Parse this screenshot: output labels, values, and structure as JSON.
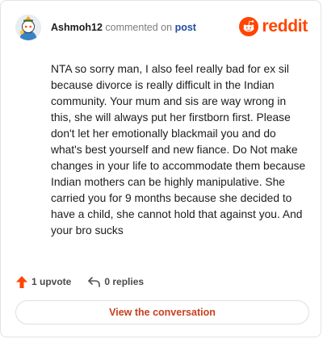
{
  "header": {
    "username": "Ashmoh12",
    "commented_on_text": "commented on",
    "post_link_label": "post",
    "brand_name": "reddit",
    "brand_color": "#ff4500"
  },
  "comment": {
    "body": "NTA so sorry man, I also feel really bad for ex sil because divorce is really difficult in the Indian community. Your mum and sis are way wrong in this, she will always put her firstborn first. Please don't let her emotionally blackmail you and do what's best yourself and new fiance. Do Not make changes in your life to accommodate them because Indian mothers can be highly manipulative. She carried you for 9 months because she decided to have a child, she cannot hold that against you. And your bro sucks"
  },
  "actions": {
    "upvote_label": "1 upvote",
    "upvote_icon": "upvote-arrow-icon",
    "replies_label": "0 replies",
    "replies_icon": "reply-arrow-icon"
  },
  "footer": {
    "view_conversation_label": "View the conversation"
  }
}
